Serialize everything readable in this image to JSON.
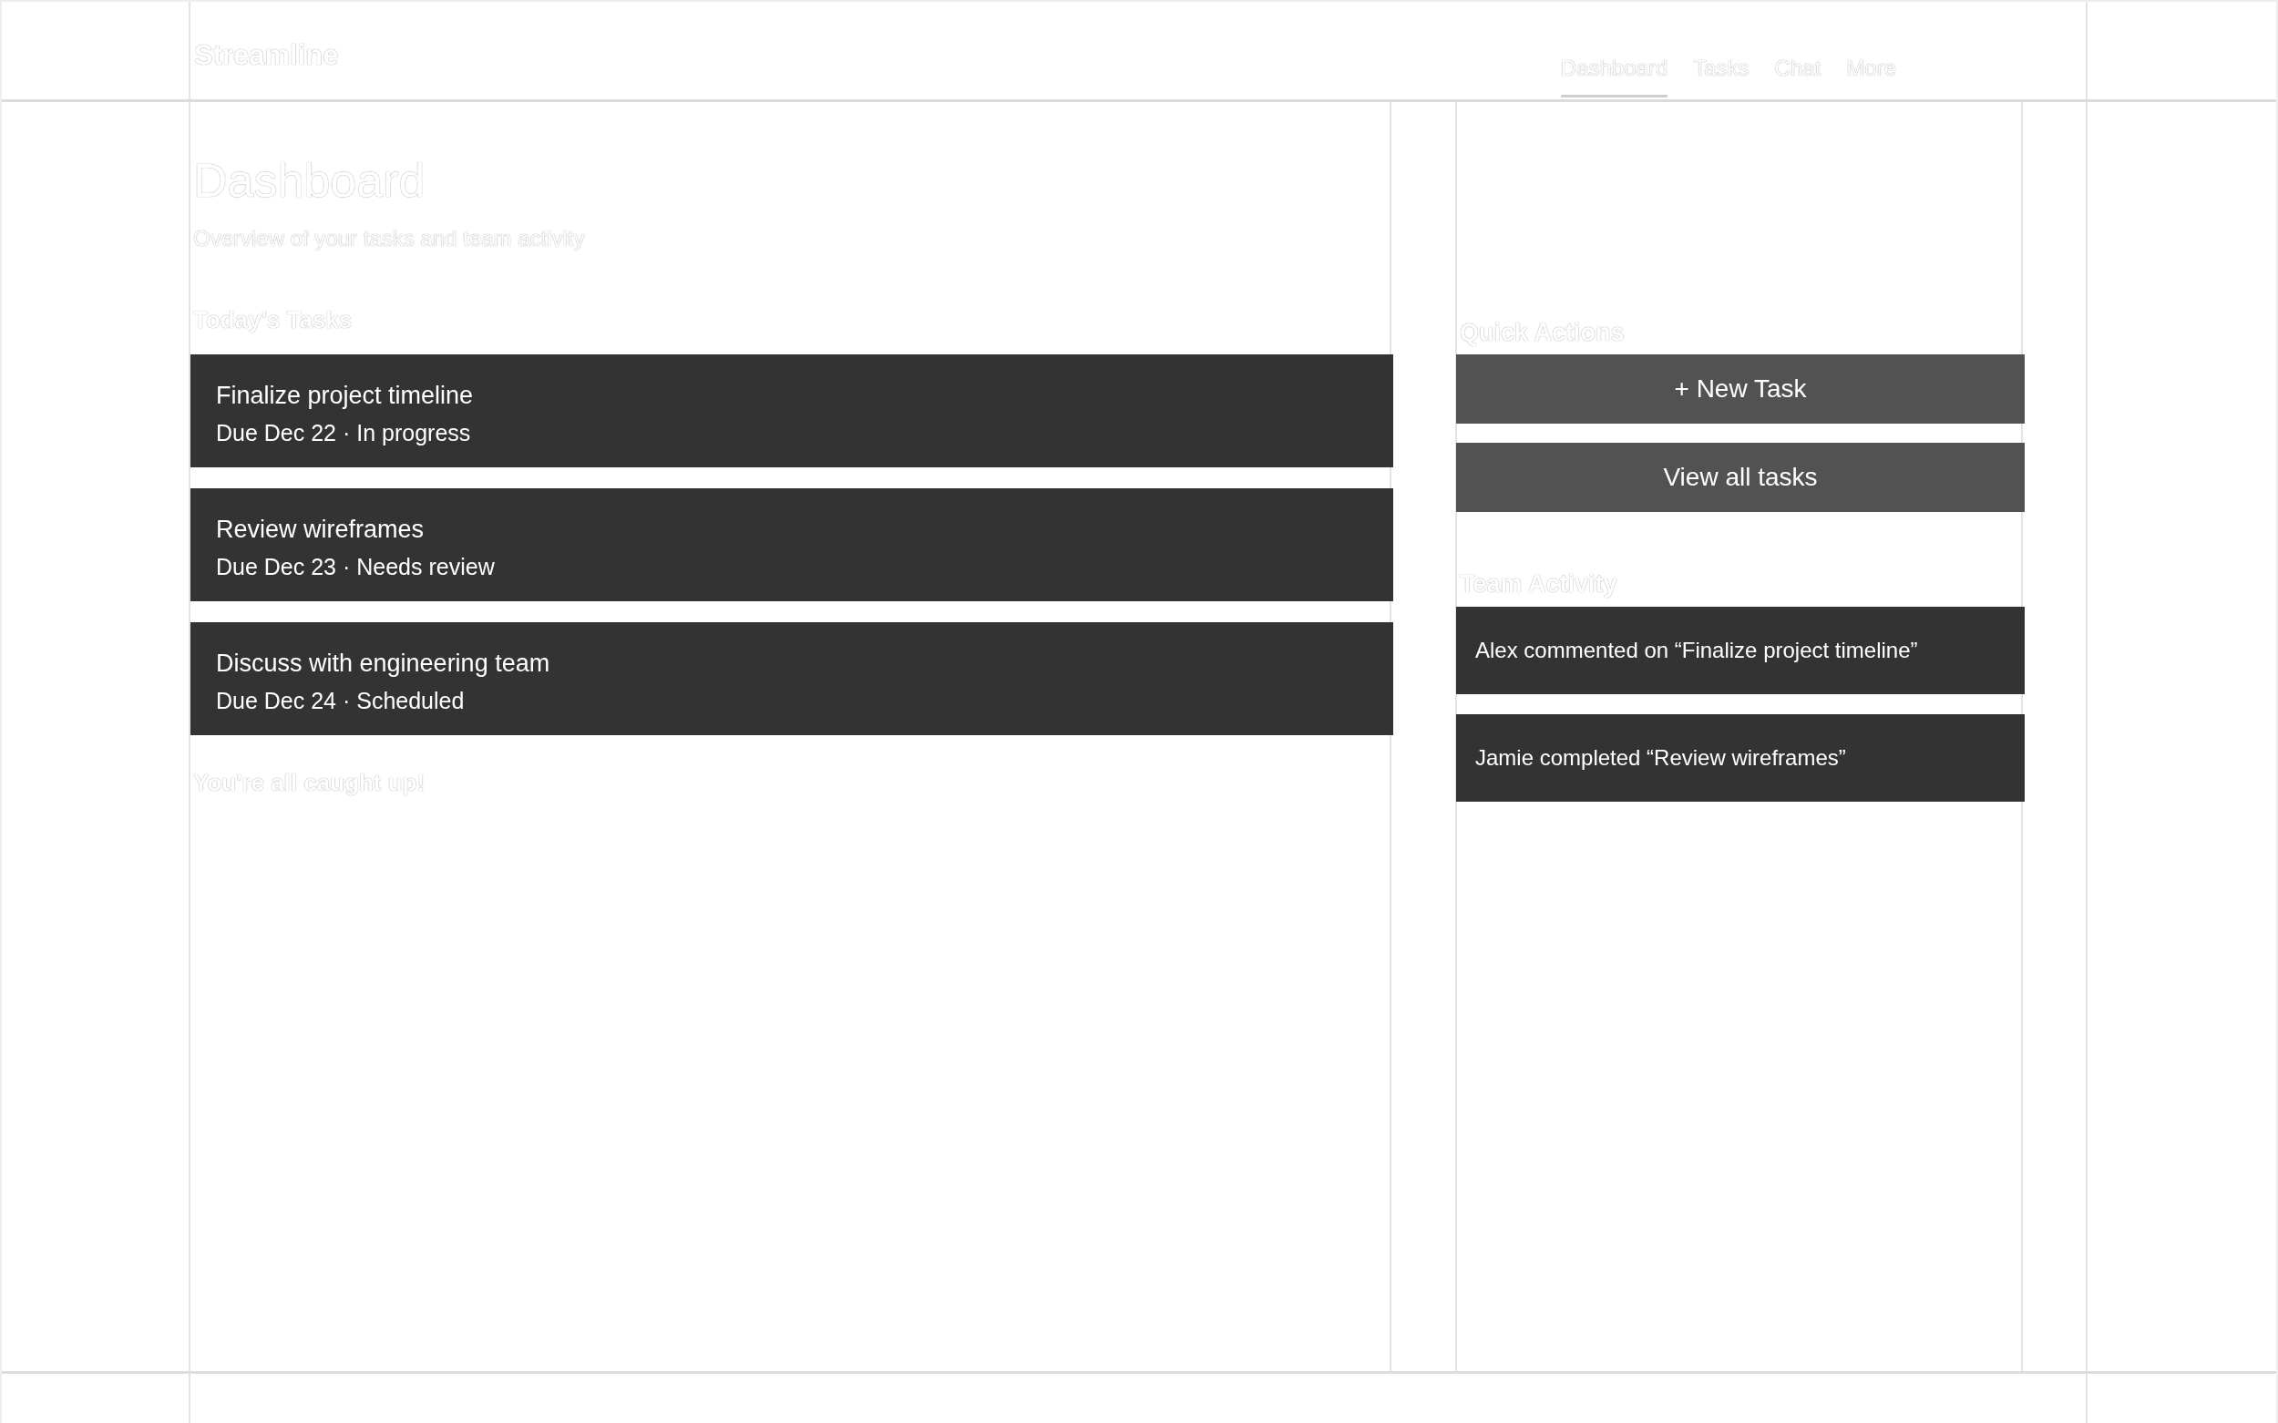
{
  "header": {
    "brand": "Streamline",
    "nav": [
      {
        "label": "Dashboard",
        "selected": true
      },
      {
        "label": "Tasks",
        "selected": false
      },
      {
        "label": "Chat",
        "selected": false
      },
      {
        "label": "More",
        "selected": false
      }
    ]
  },
  "main": {
    "title": "Dashboard",
    "subtitle": "Overview of your tasks and team activity",
    "section_title": "Today's Tasks",
    "tasks": [
      {
        "title": "Finalize project timeline",
        "meta": "Due Dec 22 · In progress"
      },
      {
        "title": "Review wireframes",
        "meta": "Due Dec 23 · Needs review"
      },
      {
        "title": "Discuss with engineering team",
        "meta": "Due Dec 24 · Scheduled"
      }
    ],
    "empty_message": "You're all caught up!"
  },
  "sidebar": {
    "quick_actions": {
      "title": "Quick Actions",
      "buttons": [
        "+ New Task",
        "View all tasks"
      ]
    },
    "team_activity": {
      "title": "Team Activity",
      "items": [
        "Alex commented on “Finalize project timeline”",
        "Jamie completed “Review wireframes”"
      ]
    }
  }
}
